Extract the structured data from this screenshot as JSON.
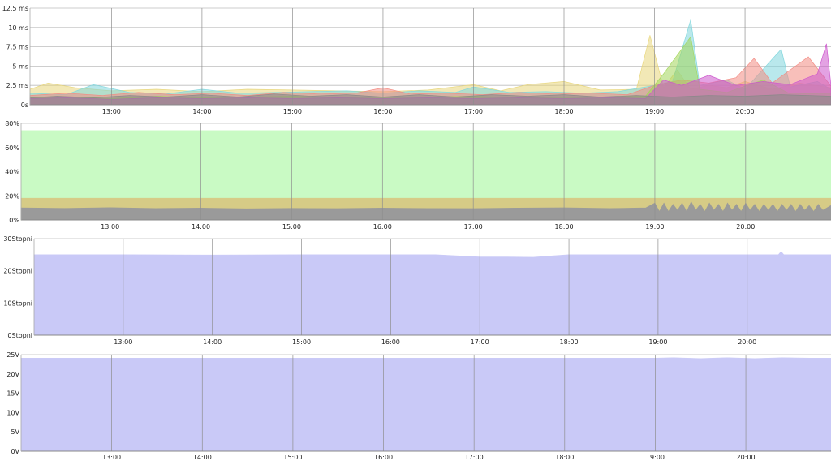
{
  "x_ticks": [
    "13:00",
    "14:00",
    "15:00",
    "16:00",
    "17:00",
    "18:00",
    "19:00",
    "20:00"
  ],
  "chart_data": [
    {
      "type": "area",
      "ylim": [
        0,
        12.5
      ],
      "y_ticks": [
        {
          "value": 0,
          "label": "0s"
        },
        {
          "value": 2.5,
          "label": "2.5 ms"
        },
        {
          "value": 5,
          "label": "5 ms"
        },
        {
          "value": 7.5,
          "label": "7.5 ms"
        },
        {
          "value": 10,
          "label": "10 ms"
        },
        {
          "value": 12.5,
          "label": "12.5 ms"
        }
      ],
      "xlim": [
        12.1,
        20.95
      ],
      "series": [
        {
          "color": "#e8d67a",
          "values": [
            [
              12.1,
              2.0
            ],
            [
              12.3,
              2.8
            ],
            [
              12.6,
              2.2
            ],
            [
              13.0,
              1.8
            ],
            [
              13.5,
              2.0
            ],
            [
              14.0,
              1.7
            ],
            [
              14.5,
              2.0
            ],
            [
              15.0,
              1.9
            ],
            [
              15.5,
              1.8
            ],
            [
              16.0,
              1.7
            ],
            [
              16.5,
              1.9
            ],
            [
              17.0,
              2.6
            ],
            [
              17.3,
              1.8
            ],
            [
              17.6,
              2.6
            ],
            [
              18.0,
              3.0
            ],
            [
              18.4,
              1.9
            ],
            [
              18.8,
              2.0
            ],
            [
              18.95,
              9.0
            ],
            [
              19.1,
              2.2
            ],
            [
              19.25,
              4.5
            ],
            [
              19.4,
              2.0
            ],
            [
              19.6,
              2.5
            ],
            [
              19.8,
              2.2
            ],
            [
              20.0,
              3.0
            ],
            [
              20.3,
              2.0
            ],
            [
              20.6,
              2.8
            ],
            [
              20.95,
              2.2
            ]
          ]
        },
        {
          "color": "#7fd6dc",
          "values": [
            [
              12.1,
              1.5
            ],
            [
              12.5,
              1.3
            ],
            [
              12.8,
              2.6
            ],
            [
              13.2,
              1.6
            ],
            [
              13.6,
              1.4
            ],
            [
              14.0,
              2.0
            ],
            [
              14.4,
              1.5
            ],
            [
              14.8,
              1.6
            ],
            [
              15.2,
              1.7
            ],
            [
              15.6,
              1.8
            ],
            [
              16.0,
              1.5
            ],
            [
              16.4,
              1.8
            ],
            [
              16.8,
              1.6
            ],
            [
              17.0,
              2.3
            ],
            [
              17.4,
              1.6
            ],
            [
              17.8,
              1.7
            ],
            [
              18.2,
              1.5
            ],
            [
              18.6,
              1.7
            ],
            [
              19.0,
              2.5
            ],
            [
              19.2,
              3.0
            ],
            [
              19.4,
              11.0
            ],
            [
              19.5,
              2.5
            ],
            [
              19.8,
              3.2
            ],
            [
              20.0,
              2.0
            ],
            [
              20.4,
              7.2
            ],
            [
              20.5,
              2.3
            ],
            [
              20.8,
              3.0
            ],
            [
              20.95,
              2.0
            ]
          ]
        },
        {
          "color": "#f28a82",
          "values": [
            [
              12.1,
              1.2
            ],
            [
              12.5,
              1.5
            ],
            [
              12.9,
              1.2
            ],
            [
              13.3,
              1.6
            ],
            [
              13.7,
              1.3
            ],
            [
              14.1,
              1.5
            ],
            [
              14.5,
              1.2
            ],
            [
              14.9,
              1.6
            ],
            [
              15.3,
              1.4
            ],
            [
              15.7,
              1.5
            ],
            [
              16.0,
              2.2
            ],
            [
              16.3,
              1.4
            ],
            [
              16.7,
              1.5
            ],
            [
              17.1,
              1.3
            ],
            [
              17.5,
              1.6
            ],
            [
              17.9,
              1.4
            ],
            [
              18.3,
              1.5
            ],
            [
              18.7,
              1.3
            ],
            [
              19.0,
              2.5
            ],
            [
              19.3,
              3.2
            ],
            [
              19.6,
              2.8
            ],
            [
              19.9,
              3.5
            ],
            [
              20.1,
              6.0
            ],
            [
              20.3,
              2.8
            ],
            [
              20.7,
              6.2
            ],
            [
              20.95,
              2.4
            ]
          ]
        },
        {
          "color": "#a2d65a",
          "values": [
            [
              12.1,
              0.9
            ],
            [
              12.5,
              1.0
            ],
            [
              13.0,
              0.8
            ],
            [
              13.5,
              1.1
            ],
            [
              14.0,
              0.9
            ],
            [
              14.5,
              1.0
            ],
            [
              15.0,
              1.1
            ],
            [
              15.5,
              0.9
            ],
            [
              16.0,
              1.0
            ],
            [
              16.5,
              1.0
            ],
            [
              17.0,
              1.1
            ],
            [
              17.5,
              0.9
            ],
            [
              18.0,
              1.0
            ],
            [
              18.5,
              1.0
            ],
            [
              18.9,
              1.1
            ],
            [
              19.1,
              4.0
            ],
            [
              19.4,
              8.8
            ],
            [
              19.5,
              2.0
            ],
            [
              19.8,
              1.6
            ],
            [
              20.2,
              3.2
            ],
            [
              20.5,
              1.4
            ],
            [
              20.95,
              1.5
            ]
          ]
        },
        {
          "color": "#cc55cc",
          "values": [
            [
              12.1,
              0.8
            ],
            [
              12.5,
              0.9
            ],
            [
              13.0,
              0.7
            ],
            [
              13.5,
              0.9
            ],
            [
              14.0,
              0.8
            ],
            [
              14.5,
              0.9
            ],
            [
              15.0,
              0.8
            ],
            [
              15.5,
              0.9
            ],
            [
              16.0,
              0.8
            ],
            [
              16.5,
              0.9
            ],
            [
              17.0,
              0.8
            ],
            [
              17.5,
              0.9
            ],
            [
              18.0,
              0.8
            ],
            [
              18.5,
              0.9
            ],
            [
              18.9,
              0.8
            ],
            [
              19.1,
              3.2
            ],
            [
              19.3,
              2.5
            ],
            [
              19.6,
              3.8
            ],
            [
              19.9,
              2.5
            ],
            [
              20.2,
              3.0
            ],
            [
              20.5,
              2.6
            ],
            [
              20.8,
              4.0
            ],
            [
              20.9,
              7.9
            ],
            [
              20.95,
              2.5
            ]
          ]
        },
        {
          "color": "#888888",
          "values": [
            [
              12.1,
              0.9
            ],
            [
              12.4,
              1.1
            ],
            [
              12.8,
              0.9
            ],
            [
              13.2,
              1.2
            ],
            [
              13.6,
              1.0
            ],
            [
              14.0,
              1.3
            ],
            [
              14.4,
              1.0
            ],
            [
              14.8,
              1.4
            ],
            [
              15.2,
              1.1
            ],
            [
              15.6,
              1.3
            ],
            [
              16.0,
              1.0
            ],
            [
              16.4,
              1.3
            ],
            [
              16.8,
              1.0
            ],
            [
              17.2,
              1.3
            ],
            [
              17.6,
              1.1
            ],
            [
              18.0,
              1.3
            ],
            [
              18.4,
              1.0
            ],
            [
              18.8,
              1.2
            ],
            [
              19.2,
              1.0
            ],
            [
              19.6,
              1.2
            ],
            [
              20.0,
              1.1
            ],
            [
              20.4,
              1.3
            ],
            [
              20.95,
              1.1
            ]
          ]
        }
      ]
    },
    {
      "type": "area",
      "ylim": [
        0,
        80
      ],
      "y_ticks": [
        {
          "value": 0,
          "label": "0%"
        },
        {
          "value": 20,
          "label": "20%"
        },
        {
          "value": 40,
          "label": "40%"
        },
        {
          "value": 60,
          "label": "60%"
        },
        {
          "value": 80,
          "label": "80%"
        }
      ],
      "xlim": [
        12.02,
        20.94
      ],
      "series": [
        {
          "color": "#c9fac4",
          "values": [
            [
              12.02,
              74
            ],
            [
              20.94,
              74
            ]
          ]
        },
        {
          "color": "#d6cb86",
          "values": [
            [
              12.02,
              18
            ],
            [
              20.94,
              18
            ]
          ]
        },
        {
          "color": "#9a9a9a",
          "values": [
            [
              12.02,
              10
            ],
            [
              12.5,
              9.6
            ],
            [
              13.0,
              10.2
            ],
            [
              13.5,
              9.5
            ],
            [
              14.0,
              9.8
            ],
            [
              14.5,
              9.3
            ],
            [
              15.0,
              9.6
            ],
            [
              15.5,
              9.4
            ],
            [
              16.0,
              9.8
            ],
            [
              16.5,
              9.5
            ],
            [
              17.0,
              9.4
            ],
            [
              17.5,
              9.9
            ],
            [
              18.0,
              10.1
            ],
            [
              18.5,
              9.5
            ],
            [
              18.9,
              10.0
            ],
            [
              19.0,
              14
            ],
            [
              19.05,
              7
            ],
            [
              19.1,
              14
            ],
            [
              19.15,
              7
            ],
            [
              19.2,
              13
            ],
            [
              19.25,
              8
            ],
            [
              19.3,
              14
            ],
            [
              19.35,
              7
            ],
            [
              19.4,
              15
            ],
            [
              19.45,
              8
            ],
            [
              19.5,
              13
            ],
            [
              19.55,
              7
            ],
            [
              19.6,
              14
            ],
            [
              19.65,
              8
            ],
            [
              19.7,
              13
            ],
            [
              19.75,
              7
            ],
            [
              19.8,
              14
            ],
            [
              19.85,
              8
            ],
            [
              19.9,
              13
            ],
            [
              19.95,
              7
            ],
            [
              20.0,
              14
            ],
            [
              20.05,
              8
            ],
            [
              20.1,
              13
            ],
            [
              20.15,
              7
            ],
            [
              20.2,
              13
            ],
            [
              20.25,
              8
            ],
            [
              20.3,
              13
            ],
            [
              20.35,
              7
            ],
            [
              20.4,
              13
            ],
            [
              20.45,
              8
            ],
            [
              20.5,
              13
            ],
            [
              20.55,
              7
            ],
            [
              20.6,
              13
            ],
            [
              20.65,
              8
            ],
            [
              20.7,
              12
            ],
            [
              20.75,
              7
            ],
            [
              20.8,
              13
            ],
            [
              20.85,
              8
            ],
            [
              20.94,
              12
            ]
          ]
        }
      ]
    },
    {
      "type": "area",
      "ylim": [
        0,
        30
      ],
      "y_ticks": [
        {
          "value": 0,
          "label": "0Stopni"
        },
        {
          "value": 10,
          "label": "10Stopni"
        },
        {
          "value": 20,
          "label": "20Stopni"
        },
        {
          "value": 30,
          "label": "30Stopni"
        }
      ],
      "xlim": [
        12.0,
        20.94
      ],
      "series": [
        {
          "color": "#c9c9f7",
          "values": [
            [
              12.0,
              25
            ],
            [
              13.0,
              25
            ],
            [
              14.0,
              24.9
            ],
            [
              15.0,
              25
            ],
            [
              16.0,
              25
            ],
            [
              16.5,
              25
            ],
            [
              17.0,
              24.3
            ],
            [
              17.3,
              24.3
            ],
            [
              17.6,
              24.2
            ],
            [
              17.8,
              24.6
            ],
            [
              18.0,
              25
            ],
            [
              19.0,
              25
            ],
            [
              20.0,
              25
            ],
            [
              20.35,
              25
            ],
            [
              20.38,
              26
            ],
            [
              20.41,
              25
            ],
            [
              20.94,
              25
            ]
          ]
        }
      ]
    },
    {
      "type": "area",
      "ylim": [
        0,
        25
      ],
      "y_ticks": [
        {
          "value": 0,
          "label": "0V"
        },
        {
          "value": 5,
          "label": "5V"
        },
        {
          "value": 10,
          "label": "10V"
        },
        {
          "value": 15,
          "label": "15V"
        },
        {
          "value": 20,
          "label": "20V"
        },
        {
          "value": 25,
          "label": "25V"
        }
      ],
      "xlim": [
        12.0,
        20.94
      ],
      "series": [
        {
          "color": "#c9c9f7",
          "values": [
            [
              12.0,
              24.1
            ],
            [
              19.0,
              24.1
            ],
            [
              19.2,
              24.2
            ],
            [
              19.5,
              24.0
            ],
            [
              19.8,
              24.2
            ],
            [
              20.1,
              24.0
            ],
            [
              20.4,
              24.2
            ],
            [
              20.7,
              24.1
            ],
            [
              20.94,
              24.1
            ]
          ]
        }
      ]
    }
  ]
}
